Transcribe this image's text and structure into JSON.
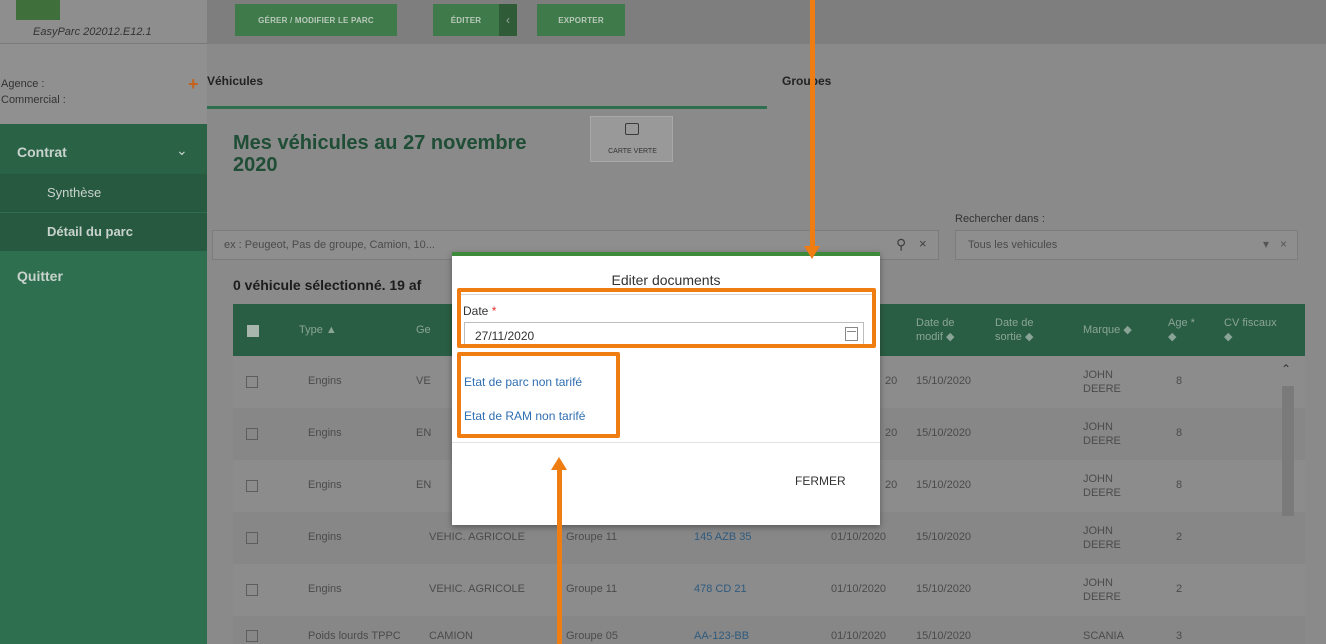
{
  "app": {
    "version": "EasyParc 202012.E12.1"
  },
  "sidebar": {
    "agency_label": "Agence :",
    "commercial_label": "Commercial :",
    "contract": "Contrat",
    "items": [
      {
        "label": "Synthèse"
      },
      {
        "label": "Détail du parc"
      }
    ],
    "quit": "Quitter"
  },
  "toolbar": {
    "manage": "GÉRER / MODIFIER LE PARC",
    "edit": "ÉDITER",
    "export": "EXPORTER"
  },
  "tabs": [
    {
      "label": "Véhicules"
    },
    {
      "label": "Groupes"
    }
  ],
  "page": {
    "title": "Mes véhicules au 27 novembre 2020",
    "carte_verte": "CARTE VERTE",
    "search_in_label": "Rechercher dans :",
    "search_placeholder": "ex : Peugeot, Pas de groupe, Camion, 10...",
    "search_scope": "Tous les vehicules",
    "count_text": "0 véhicule sélectionné. 19 af"
  },
  "table": {
    "headers": {
      "type": "Type ▲",
      "genre": "Ge",
      "modif": "Date de modif ◆",
      "sortie": "Date de sortie ◆",
      "marque": "Marque ◆",
      "age": "Age * ◆",
      "cv": "CV fiscaux ◆"
    },
    "rows": [
      {
        "type": "Engins",
        "genre": "VE",
        "groupe": "",
        "immat": "",
        "date": "20",
        "modif": "15/10/2020",
        "marque_1": "JOHN",
        "marque_2": "DEERE",
        "age": "8"
      },
      {
        "type": "Engins",
        "genre": "EN",
        "groupe": "",
        "immat": "",
        "date": "20",
        "modif": "15/10/2020",
        "marque_1": "JOHN",
        "marque_2": "DEERE",
        "age": "8"
      },
      {
        "type": "Engins",
        "genre": "EN",
        "groupe": "",
        "immat": "",
        "date": "20",
        "modif": "15/10/2020",
        "marque_1": "JOHN",
        "marque_2": "DEERE",
        "age": "8"
      },
      {
        "type": "Engins",
        "genre": "VEHIC. AGRICOLE",
        "groupe": "Groupe 11",
        "immat": "145 AZB 35",
        "date": "01/10/2020",
        "modif": "15/10/2020",
        "marque_1": "JOHN",
        "marque_2": "DEERE",
        "age": "2"
      },
      {
        "type": "Engins",
        "genre": "VEHIC. AGRICOLE",
        "groupe": "Groupe 11",
        "immat": "478 CD 21",
        "date": "01/10/2020",
        "modif": "15/10/2020",
        "marque_1": "JOHN",
        "marque_2": "DEERE",
        "age": "2"
      },
      {
        "type": "Poids lourds TPPC",
        "genre": "CAMION",
        "groupe": "Groupe 05",
        "immat": "AA-123-BB",
        "date": "01/10/2020",
        "modif": "15/10/2020",
        "marque_1": "SCANIA",
        "marque_2": "",
        "age": "3"
      }
    ]
  },
  "modal": {
    "title": "Editer documents",
    "date_label": "Date",
    "date_required": "*",
    "date_value": "27/11/2020",
    "links": [
      "Etat de parc non tarifé",
      "Etat de RAM non tarifé"
    ],
    "close": "FERMER"
  },
  "colors": {
    "accent": "#2f6e4f",
    "annotation": "#f07d12",
    "link": "#2f6fb2",
    "required": "#e52f2f"
  }
}
